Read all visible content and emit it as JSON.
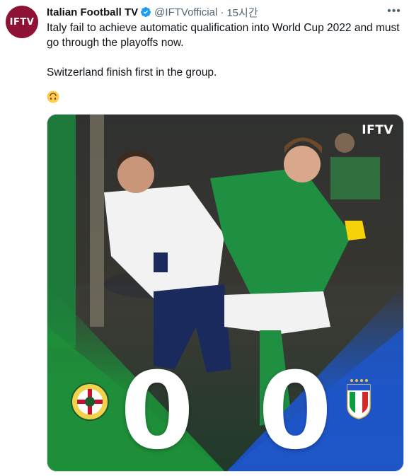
{
  "tweet": {
    "avatar_text": "IFTV",
    "author_name": "Italian Football TV",
    "handle": "@IFTVofficial",
    "separator": "·",
    "time": "15시간",
    "more_label": "•••",
    "text_line1": "Italy fail to achieve automatic qualification into World Cup 2022 and must go through the playoffs now.",
    "text_line2": "Switzerland finish first in the group.",
    "emoji": "upside-down-face-emoji"
  },
  "media": {
    "brand_text": "IFTV",
    "score_home": "0",
    "score_away": "0",
    "home_crest": "northern-ireland-crest",
    "away_crest": "italia-crest",
    "colors": {
      "home": "#1e8f3a",
      "away": "#1f56c8",
      "avatar": "#8d1236",
      "verified": "#1d9bf0"
    }
  }
}
